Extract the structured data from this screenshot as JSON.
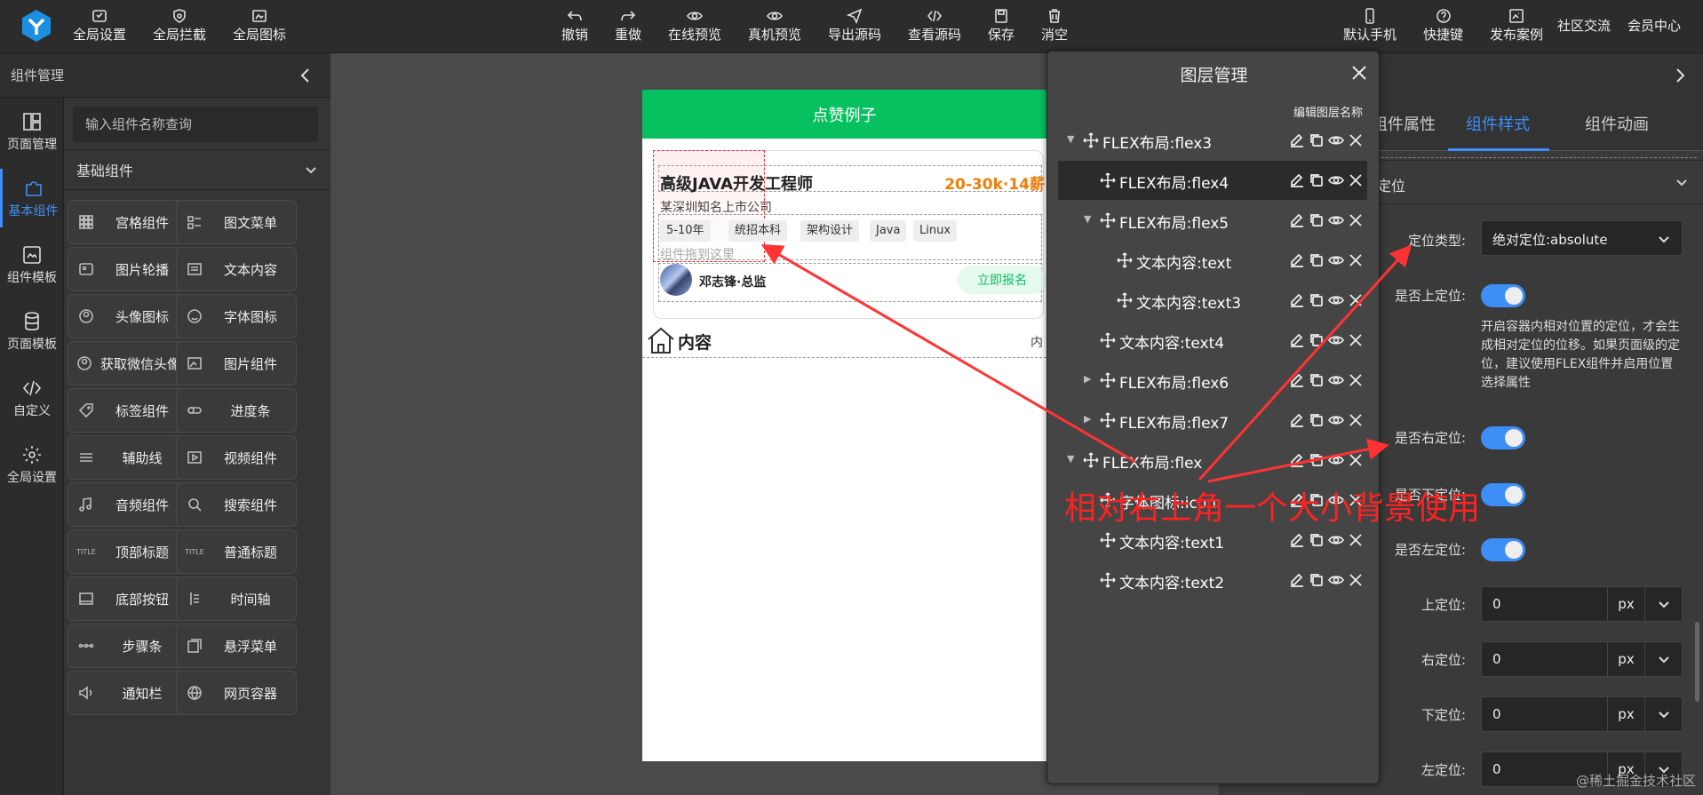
{
  "toolbar": {
    "left": [
      "全局设置",
      "全局拦截",
      "全局图标"
    ],
    "center": [
      "撤销",
      "重做",
      "在线预览",
      "真机预览",
      "导出源码",
      "查看源码",
      "保存",
      "消空"
    ],
    "right_icon": [
      "默认手机",
      "快捷键",
      "发布案例"
    ],
    "right_text": [
      "社区交流",
      "会员中心"
    ]
  },
  "rail": [
    "页面管理",
    "基本组件",
    "组件模板",
    "页面模板",
    "自定义",
    "全局设置"
  ],
  "component_panel": {
    "title": "组件管理",
    "search_placeholder": "输入组件名称查询",
    "section": "基础组件",
    "items": [
      [
        "宫格组件",
        "图文菜单"
      ],
      [
        "图片轮播",
        "文本内容"
      ],
      [
        "头像图标",
        "字体图标"
      ],
      [
        "获取微信头像",
        "图片组件"
      ],
      [
        "标签组件",
        "进度条"
      ],
      [
        "辅助线",
        "视频组件"
      ],
      [
        "音频组件",
        "搜索组件"
      ],
      [
        "顶部标题",
        "普通标题"
      ],
      [
        "底部按钮",
        "时间轴"
      ],
      [
        "步骤条",
        "悬浮菜单"
      ],
      [
        "通知栏",
        "网页容器"
      ]
    ],
    "icon_title_text": "TITLE"
  },
  "phone": {
    "title": "点赞例子",
    "job_title": "高级JAVA开发工程师",
    "salary": "20-30k·14薪",
    "company": "某深圳知名上市公司",
    "tags": [
      "5-10年",
      "统招本科",
      "架构设计",
      "Java",
      "Linux"
    ],
    "drop_hint": "组件拖到这里",
    "person": "邓志锋·总监",
    "apply": "立即报名",
    "home_text": "内容",
    "home_right": "内"
  },
  "layer_panel": {
    "title": "图层管理",
    "edit_label": "编辑图层名称",
    "rows": [
      "FLEX布局:flex3",
      "FLEX布局:flex4",
      "FLEX布局:flex5",
      "文本内容:text",
      "文本内容:text3",
      "文本内容:text4",
      "FLEX布局:flex6",
      "FLEX布局:flex7",
      "FLEX布局:flex",
      "字体图标:icon",
      "文本内容:text1",
      "文本内容:text2"
    ]
  },
  "style_panel": {
    "tabs": [
      "组件属性",
      "组件样式",
      "组件动画"
    ],
    "active_tab": "组件样式",
    "section": "定位",
    "position_type_label": "定位类型:",
    "position_type_value": "绝对定位:absolute",
    "top_enabled_label": "是否上定位:",
    "help_text": "开启容器内相对位置的定位，才会生成相对定位的位移。如果页面级的定位，建议使用FLEX组件并启用位置选择属性",
    "right_enabled_label": "是否右定位:",
    "bottom_enabled_label": "是否下定位:",
    "left_enabled_label": "是否左定位:",
    "top_label": "上定位:",
    "right_label": "右定位:",
    "bottom_label": "下定位:",
    "left_label": "左定位:",
    "top_value": "0",
    "right_value": "0",
    "bottom_value": "0",
    "left_value": "0",
    "unit": "px"
  },
  "annotation": "相对右上角一个大小背景使用",
  "watermark": "@稀土掘金技术社区",
  "colors": {
    "accent": "#3e8ef7",
    "brand_green": "#07c160",
    "salary": "#ee7f0a",
    "annotation": "#ff2222"
  }
}
